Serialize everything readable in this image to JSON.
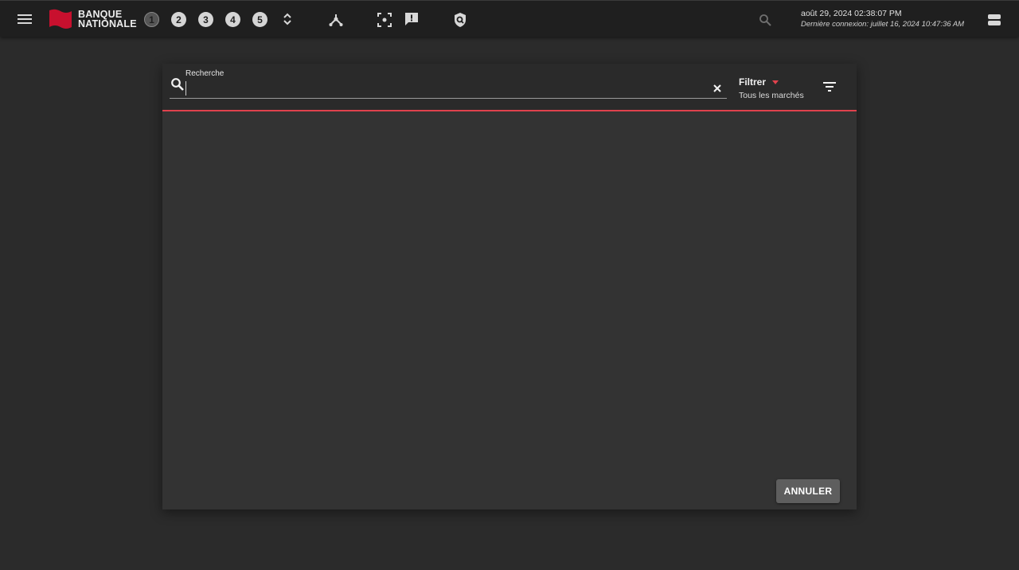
{
  "topbar": {
    "brand_line1": "BANQUE",
    "brand_line2": "NATIONALE",
    "workspaces": [
      "1",
      "2",
      "3",
      "4",
      "5"
    ],
    "active_workspace": "1",
    "datetime": "août 29, 2024 02:38:07 PM",
    "last_login": "Dernière connexion: juillet 16, 2024 10:47:36 AM",
    "icons": [
      "menu-icon",
      "workspace-switch-icon",
      "network-icon",
      "focus-icon",
      "feedback-icon",
      "shield-search-icon",
      "search-icon",
      "server-icon"
    ]
  },
  "dialog": {
    "search_label": "Recherche",
    "search_value": "",
    "search_placeholder": "",
    "filter_title": "Filtrer",
    "filter_value": "Tous les marchés",
    "cancel_label": "ANNULER"
  },
  "colors": {
    "accent": "#e0424d",
    "brand_red": "#c8102e",
    "background": "#2b2b2b",
    "topbar": "#1f1f1f",
    "dialog": "#333333"
  }
}
